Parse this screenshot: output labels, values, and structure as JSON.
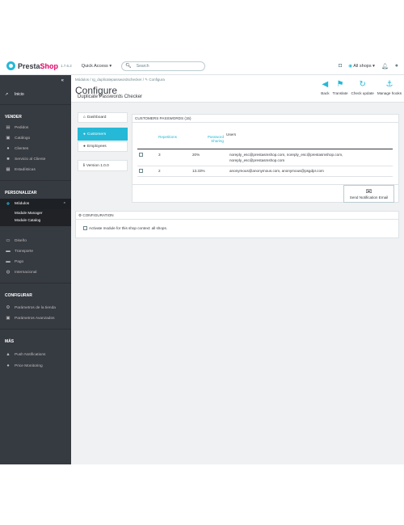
{
  "header": {
    "logo_name_prefix": "Presta",
    "logo_name_suffix": "Shop",
    "version": "1.7.6.2",
    "quick_access": "Quick Access ▾",
    "search_placeholder": "Search",
    "shops_label": "All shops ▾"
  },
  "sidebar": {
    "home": "Inicio",
    "sections": {
      "vender": "VENDER",
      "personalizar": "PERSONALIZAR",
      "configurar": "CONFIGURAR",
      "mas": "MÁS"
    },
    "vender_items": [
      "Pedidos",
      "Catálogo",
      "Clientes",
      "Servicio al Cliente",
      "Estadísticas"
    ],
    "modules_label": "Módulos",
    "modules_sub": [
      "Module Manager",
      "Module Catalog"
    ],
    "personalizar_items": [
      "Diseño",
      "Transporte",
      "Pago",
      "Internacional"
    ],
    "configurar_items": [
      "Parámetros de la tienda",
      "Parámetros Avanzados"
    ],
    "mas_items": [
      "Push Notifications",
      "Price Monitoring"
    ]
  },
  "page": {
    "breadcrumb": "Módulos  /  rg_duplicatepasswordschecker  /  ✎ Configura",
    "title": "Configure",
    "subtitle": "Duplicate Passwords Checker",
    "toolbar": [
      "Back",
      "Translate",
      "Check update",
      "Manage hooks"
    ]
  },
  "tabs": {
    "dashboard": "Dashboard",
    "customers": "Customers",
    "employees": "Employees",
    "version": "Version 1.0.0"
  },
  "customers_panel": {
    "heading": "CUSTOMERS PASSWORDS (15)",
    "columns": {
      "repetitions": "Repetitions",
      "password_sharing": "Password Sharing",
      "users": "Users"
    },
    "rows": [
      {
        "repetitions": "3",
        "sharing": "20%",
        "users": "noreply_esc@prestasmshop.com, noreply_esc@prestasmshop.com, noreply_esc@prestasmshop.com"
      },
      {
        "repetitions": "2",
        "sharing": "13.33%",
        "users": "anonymous@anonymous.com, anonymous@psgdpr.com"
      }
    ],
    "notify_button": "Send Notification Email"
  },
  "config_panel": {
    "heading": "CONFIGURATION",
    "checkbox_label": "Activate module for this shop context: all shops."
  }
}
